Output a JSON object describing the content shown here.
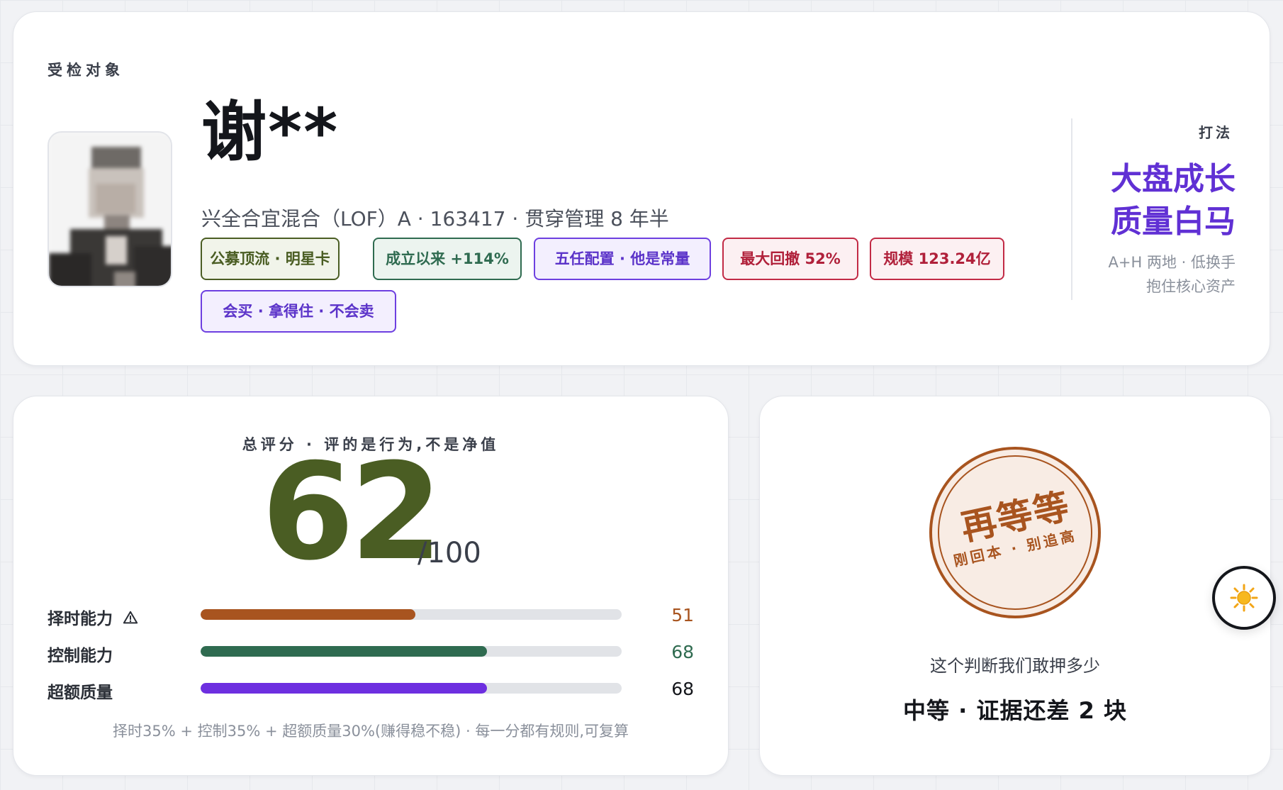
{
  "profile": {
    "section_label": "受检对象",
    "name": "谢**",
    "subtitle": "兴全合宜混合（LOF）A · 163417 · 贯穿管理 8 年半",
    "tags": [
      {
        "label": "公募顶流 · 明星卡",
        "tone": "olive"
      },
      {
        "label": "成立以来 +114%",
        "tone": "green"
      },
      {
        "label": "五任配置 · 他是常量",
        "tone": "purple"
      },
      {
        "label": "最大回撤 52%",
        "tone": "red"
      },
      {
        "label": "规模 123.24亿",
        "tone": "red"
      },
      {
        "label": "会买 · 拿得住 · 不会卖",
        "tone": "purple"
      }
    ],
    "style_label": "打法",
    "style_title_line1": "大盘成长",
    "style_title_line2": "质量白马",
    "style_desc_line1": "A+H 两地 · 低换手",
    "style_desc_line2": "抱住核心资产"
  },
  "score": {
    "heading": "总评分 · 评的是行为,不是净值",
    "value": "62",
    "max": "/100",
    "metrics": [
      {
        "label": "择时能力",
        "value": "51",
        "percent": 51,
        "color": "#a8541f",
        "warning": true
      },
      {
        "label": "控制能力",
        "value": "68",
        "percent": 68,
        "color": "#2f6b50",
        "warning": false
      },
      {
        "label": "超额质量",
        "value": "68",
        "percent": 68,
        "color": "#6d2fe0",
        "warning": false
      }
    ],
    "formula": "择时35% + 控制35% + 超额质量30%(赚得稳不稳) · 每一分都有规则,可复算"
  },
  "verdict": {
    "stamp_main": "再等等",
    "stamp_sub": "刚回本 · 别追高",
    "question": "这个判断我们敢押多少",
    "answer": "中等 · 证据还差 2 块"
  },
  "theme_toggle": {
    "icon": "sun-icon"
  },
  "colors": {
    "accent_purple": "#6030d4",
    "score_green": "#4a5d23",
    "stamp_brown": "#a8541f"
  }
}
